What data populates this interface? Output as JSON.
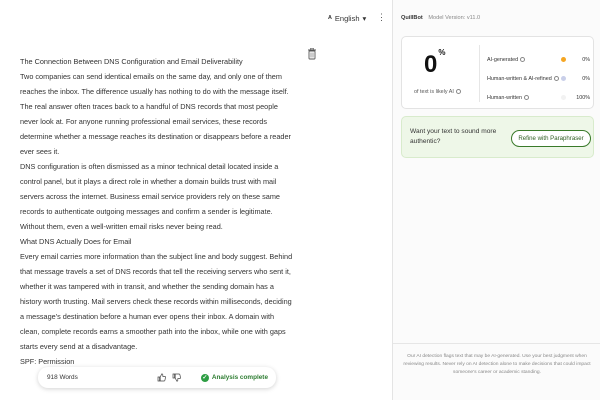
{
  "toolbar": {
    "language": "English",
    "language_icon": "translate-icon",
    "menu_icon": "kebab-icon"
  },
  "editor": {
    "paragraphs": [
      "The Connection Between DNS Configuration and Email Deliverability",
      "Two companies can send identical emails on the same day, and only one of them reaches the inbox. The difference usually has nothing to do with the message itself. The real answer often traces back to a handful of DNS records that most people never look at. For anyone running professional email services, these records determine whether a message reaches its destination or disappears before a reader ever sees it.",
      "DNS configuration is often dismissed as a minor technical detail located inside a control panel, but it plays a direct role in whether a domain builds trust with mail servers across the internet. Business email service providers rely on these same records to authenticate outgoing messages and confirm a sender is legitimate. Without them, even a well-written email risks never being read.",
      "What DNS Actually Does for Email",
      "Every email carries more information than the subject line and body suggest. Behind that message travels a set of DNS records that tell the receiving servers who sent it, whether it was tampered with in transit, and whether the sending domain has a history worth trusting. Mail servers check these records within milliseconds, deciding a message's destination before a human ever opens their inbox. A domain with clean, complete records earns a smoother path into the inbox, while one with gaps starts every send at a disadvantage.",
      "SPF: Permission"
    ]
  },
  "footer": {
    "words": "918 Words",
    "status": "Analysis complete"
  },
  "panel": {
    "brand": "QuillBot",
    "model": "Model Version: v11.0",
    "score": "0",
    "score_unit": "%",
    "score_label": "of text is likely AI",
    "rows": [
      {
        "name": "AI-generated",
        "value": "0%",
        "color": "#f5a623"
      },
      {
        "name": "Human-written & AI-refined",
        "value": "0%",
        "color": "#c9cfe9"
      },
      {
        "name": "Human-written",
        "value": "100%",
        "color": "#f2f2f2"
      }
    ],
    "promo_text": "Want your text to sound more authentic?",
    "promo_button": "Refine with Paraphraser",
    "disclaimer": "Our AI detection flags text that may be AI-generated. Use your best judgment when reviewing results. Never rely on AI detection alone to make decisions that could impact someone's career or academic standing."
  }
}
